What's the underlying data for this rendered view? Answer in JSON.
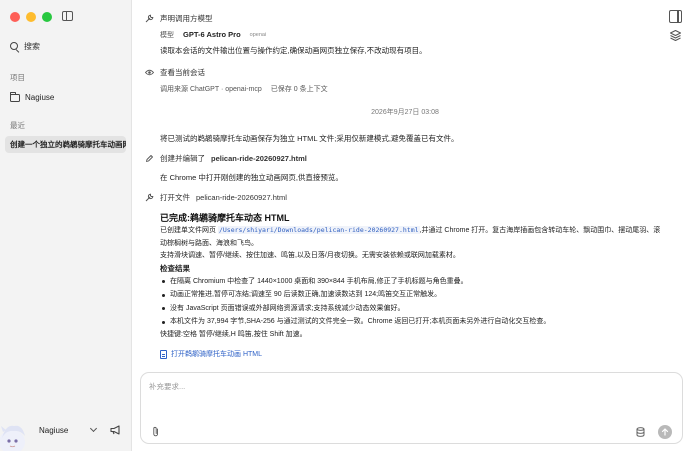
{
  "sidebar": {
    "search_label": "搜索",
    "projects_label": "项目",
    "project_name": "Nagiuse",
    "recent_label": "最近",
    "recent_item": "创建一个独立的鹈鹕骑摩托车动画网",
    "user_name": "Nagiuse"
  },
  "chat": {
    "declare_model": "声明调用方模型",
    "model_label": "模型",
    "model_name": "GPT-6 Astro Pro",
    "model_tag": "openai",
    "intro_msg": "读取本会话的文件输出位置与操作约定,确保动画网页独立保存,不改动现有项目。",
    "view_session": "查看当前会话",
    "source_label": "调用来源 ChatGPT · openai-mcp",
    "saved_label": "已保存 0 条上下文",
    "timestamp": "2026年9月27日 03:08",
    "status_msg": "将已测试的鹈鹕骑摩托车动画保存为独立 HTML 文件;采用仅新建模式,避免覆盖已有文件。",
    "created_label": "创建并编辑了",
    "created_file": "pelican-ride-20260927.html",
    "open_chrome_msg": "在 Chrome 中打开刚创建的独立动画网页,供直接预览。",
    "open_file_label": "打开文件",
    "open_file_name": "pelican-ride-20260927.html",
    "done_title": "已完成:鹈鹕骑摩托车动态 HTML",
    "created_single_prefix": "已创建单文件网页",
    "file_path": "/Users/shiyari/Downloads/pelican-ride-20260927.html",
    "created_single_suffix": ",并通过 Chrome 打开。复古海岸插画包含转动车轮、飘动围巾、摆动尾羽、滚动棕榈树与路面、海浪和飞鸟。",
    "support_line": "支持滑块调速、暂停/继续、按住加速、鸣笛,以及日落/月夜切换。无需安装依赖或联网加载素材。",
    "check_title": "检查结果",
    "checks": [
      "在隔离 Chromium 中检查了 1440×1000 桌面和 390×844 手机布局,修正了手机标题与角色重叠。",
      "动画正常推进,暂停可冻结;调速至 90 后读数正确,加速读数达到 124;鸣笛交互正常触发。",
      "没有 JavaScript 页面错误或外部网络资源请求;支持系统减少动态效果偏好。",
      "本机文件为 37,994 字节,SHA-256 与通过测试的文件完全一致。Chrome 返回已打开;本机页面未另外进行自动化交互检查。"
    ],
    "shortcut_line": "快捷键:空格 暂停/继续,H 鸣笛,按住 Shift 加速。",
    "open_link": "打开鹈鹕骑摩托车动画 HTML"
  },
  "composer": {
    "placeholder": "补充要求..."
  }
}
